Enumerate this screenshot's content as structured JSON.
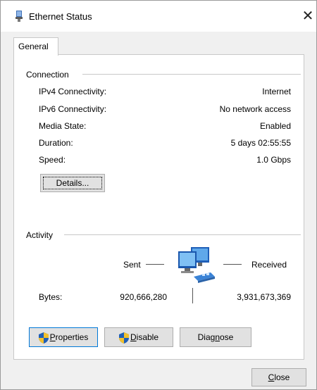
{
  "window": {
    "title": "Ethernet Status",
    "close_glyph": "✕"
  },
  "tabs": [
    {
      "label": "General"
    }
  ],
  "connection": {
    "group_label": "Connection",
    "rows": [
      {
        "label": "IPv4 Connectivity:",
        "value": "Internet"
      },
      {
        "label": "IPv6 Connectivity:",
        "value": "No network access"
      },
      {
        "label": "Media State:",
        "value": "Enabled"
      },
      {
        "label": "Duration:",
        "value": "5 days 02:55:55"
      },
      {
        "label": "Speed:",
        "value": "1.0 Gbps"
      }
    ],
    "details_button": "Details..."
  },
  "activity": {
    "group_label": "Activity",
    "sent_label": "Sent",
    "received_label": "Received",
    "bytes_label": "Bytes:",
    "bytes_sent": "920,666,280",
    "bytes_received": "3,931,673,369"
  },
  "buttons": {
    "properties": {
      "mnemonic": "P",
      "rest": "roperties"
    },
    "disable": {
      "mnemonic": "D",
      "rest": "isable"
    },
    "diagnose": {
      "pre": "Diag",
      "mnemonic": "n",
      "rest": "ose"
    },
    "close": {
      "mnemonic": "C",
      "rest": "lose"
    }
  },
  "icons": {
    "title": "network-adapter-icon",
    "activity": "network-computers-icon",
    "uac_shield": "uac-shield-icon"
  },
  "colors": {
    "focus_border": "#0078d7",
    "window_bg": "#f0f0f0",
    "panel_bg": "#ffffff"
  }
}
